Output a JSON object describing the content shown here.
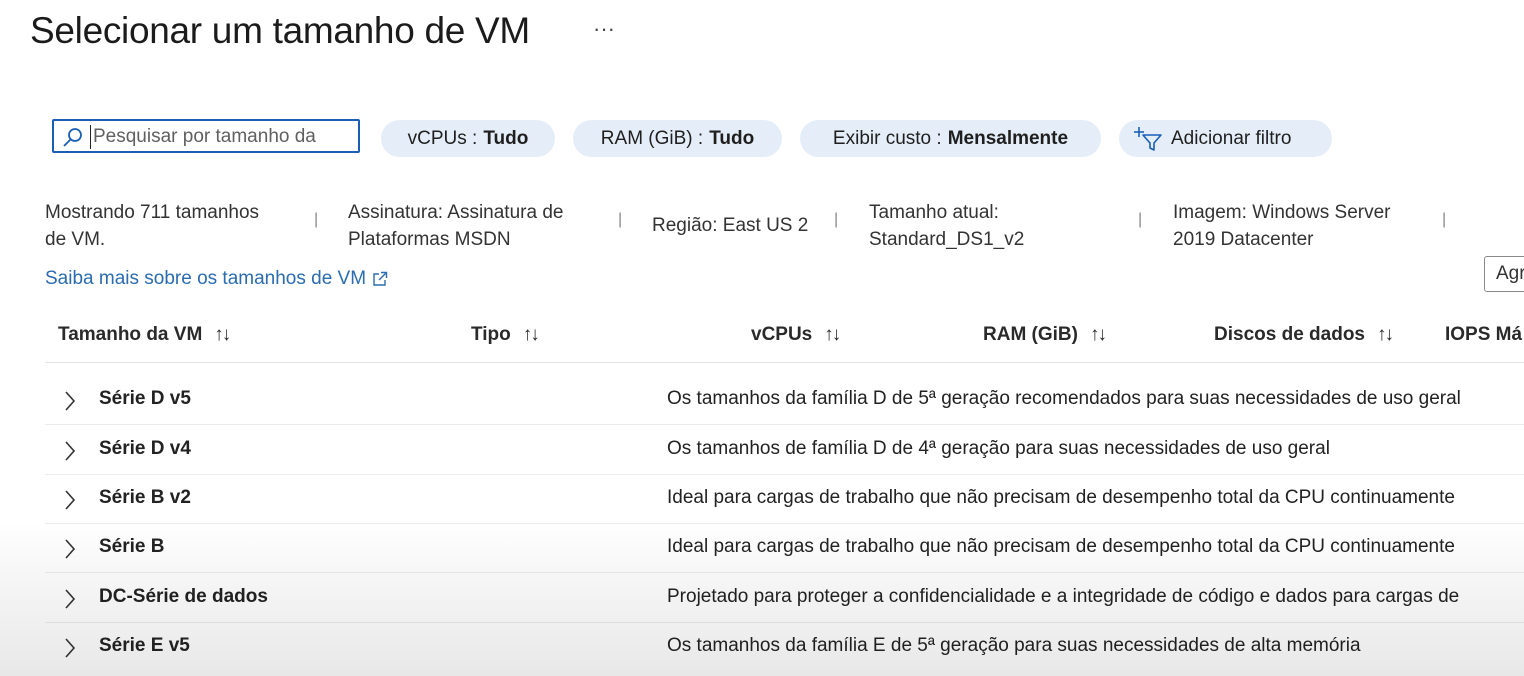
{
  "page": {
    "title": "Selecionar um tamanho de VM",
    "more": "···"
  },
  "search": {
    "placeholder": "Pesquisar por tamanho da"
  },
  "filters": {
    "vcpus": {
      "label": "vCPUs :",
      "value": "Tudo"
    },
    "ram": {
      "label": "RAM (GiB) :",
      "value": "Tudo"
    },
    "cost": {
      "label": "Exibir custo :",
      "value": "Mensalmente"
    },
    "add": {
      "label": "Adicionar filtro"
    }
  },
  "info": {
    "count": [
      "Mostrando 711 tamanhos",
      "de VM."
    ],
    "subscription": [
      "Assinatura: Assinatura de",
      "Plataformas MSDN"
    ],
    "region": "Região: East US 2",
    "current_size": [
      "Tamanho atual:",
      "Standard_DS1_v2"
    ],
    "image": [
      "Imagem: Windows Server",
      "2019 Datacenter"
    ],
    "separator": "|"
  },
  "learn_more": {
    "label": "Saiba mais sobre os tamanhos de VM"
  },
  "group_button": {
    "label": "Agr"
  },
  "columns": [
    {
      "label": "Tamanho da VM",
      "sort": "↑↓"
    },
    {
      "label": "Tipo",
      "sort": "↑↓"
    },
    {
      "label": "vCPUs",
      "sort": "↑↓"
    },
    {
      "label": "RAM (GiB)",
      "sort": "↑↓"
    },
    {
      "label": "Discos de dados",
      "sort": "↑↓"
    },
    {
      "label": "IOPS Má",
      "sort": ""
    }
  ],
  "rows": [
    {
      "name": "Série D v5",
      "desc": "Os tamanhos da família D de 5ª geração recomendados para suas necessidades de uso geral"
    },
    {
      "name": "Série D v4",
      "desc": "Os tamanhos de família D de 4ª geração para suas necessidades de uso geral"
    },
    {
      "name": "Série B v2",
      "desc": "Ideal para cargas de trabalho que não precisam de desempenho total da CPU continuamente"
    },
    {
      "name": "Série B",
      "desc": "Ideal para cargas de trabalho que não precisam de desempenho total da CPU continuamente"
    },
    {
      "name": "DC-Série de dados",
      "desc": "Projetado para proteger a confidencialidade e a integridade de código e dados para cargas de"
    },
    {
      "name": "Série E v5",
      "desc": "Os tamanhos da família E de 5ª geração para suas necessidades de alta memória"
    }
  ],
  "colors": {
    "accent": "#1a5fb4",
    "pill_bg": "#e5eef8",
    "link": "#2b6cb0"
  }
}
